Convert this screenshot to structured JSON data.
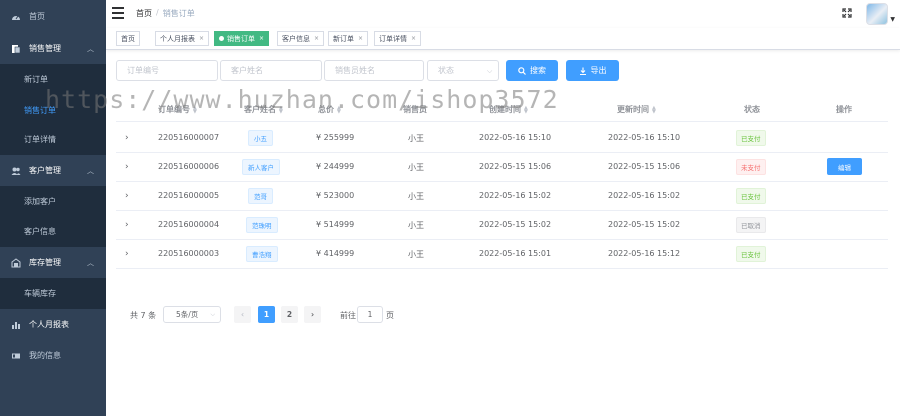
{
  "sidebar": {
    "items": [
      {
        "label": "首页",
        "icon": "dashboard-icon"
      },
      {
        "label": "销售管理",
        "icon": "document-icon",
        "expanded": true,
        "children": [
          {
            "label": "新订单"
          },
          {
            "label": "销售订单",
            "active": true
          },
          {
            "label": "订单详情"
          }
        ]
      },
      {
        "label": "客户管理",
        "icon": "users-icon",
        "expanded": true,
        "children": [
          {
            "label": "添加客户"
          },
          {
            "label": "客户信息"
          }
        ]
      },
      {
        "label": "库存管理",
        "icon": "warehouse-icon",
        "expanded": true,
        "children": [
          {
            "label": "车辆库存"
          }
        ]
      },
      {
        "label": "个人月报表",
        "icon": "bar-chart-icon"
      },
      {
        "label": "我的信息",
        "icon": "id-card-icon"
      }
    ],
    "colors": {
      "bg": "#304156",
      "submenu_bg": "#1f2d3d",
      "active": "#409eff"
    }
  },
  "navbar": {
    "breadcrumb": {
      "home": "首页",
      "separator": "/",
      "current": "销售订单"
    }
  },
  "tags": [
    {
      "label": "首页"
    },
    {
      "label": "个人月报表"
    },
    {
      "label": "销售订单",
      "active": true
    },
    {
      "label": "客户信息"
    },
    {
      "label": "新订单"
    },
    {
      "label": "订单详情"
    }
  ],
  "tag_close": "×",
  "filters": {
    "order_no_placeholder": "订单编号",
    "customer_placeholder": "客户姓名",
    "salesperson_placeholder": "销售员姓名",
    "status_placeholder": "状态",
    "search_label": "搜索",
    "export_label": "导出"
  },
  "table": {
    "headers": {
      "order_no": "订单编号",
      "customer": "客户姓名",
      "total": "总价",
      "salesperson": "销售员",
      "created": "创建时间",
      "updated": "更新时间",
      "status": "状态",
      "actions": "操作"
    },
    "rows": [
      {
        "order_no": "220516000007",
        "customer": "小五",
        "total": "¥ 255999",
        "salesperson": "小王",
        "created": "2022-05-16 15:10",
        "updated": "2022-05-16 15:10",
        "status": "已支付",
        "status_type": "paid",
        "action": ""
      },
      {
        "order_no": "220516000006",
        "customer": "新人客户",
        "total": "¥ 244999",
        "salesperson": "小王",
        "created": "2022-05-15 15:06",
        "updated": "2022-05-15 15:06",
        "status": "未支付",
        "status_type": "unpaid",
        "action": "编辑"
      },
      {
        "order_no": "220516000005",
        "customer": "范哥",
        "total": "¥ 523000",
        "salesperson": "小王",
        "created": "2022-05-16 15:02",
        "updated": "2022-05-16 15:02",
        "status": "已支付",
        "status_type": "paid",
        "action": ""
      },
      {
        "order_no": "220516000004",
        "customer": "范珠明",
        "total": "¥ 514999",
        "salesperson": "小王",
        "created": "2022-05-15 15:02",
        "updated": "2022-05-15 15:02",
        "status": "已取消",
        "status_type": "cancel",
        "action": ""
      },
      {
        "order_no": "220516000003",
        "customer": "曹浩翔",
        "total": "¥ 414999",
        "salesperson": "小王",
        "created": "2022-05-16 15:01",
        "updated": "2022-05-16 15:12",
        "status": "已支付",
        "status_type": "paid",
        "action": ""
      }
    ]
  },
  "pagination": {
    "total": "共 7 条",
    "page_size": "5条/页",
    "pages": [
      "1",
      "2"
    ],
    "current": "1",
    "goto_label": "前往",
    "goto_value": "1",
    "page_label": "页"
  },
  "watermark": "https://www.huzhan.com/ishop3572"
}
